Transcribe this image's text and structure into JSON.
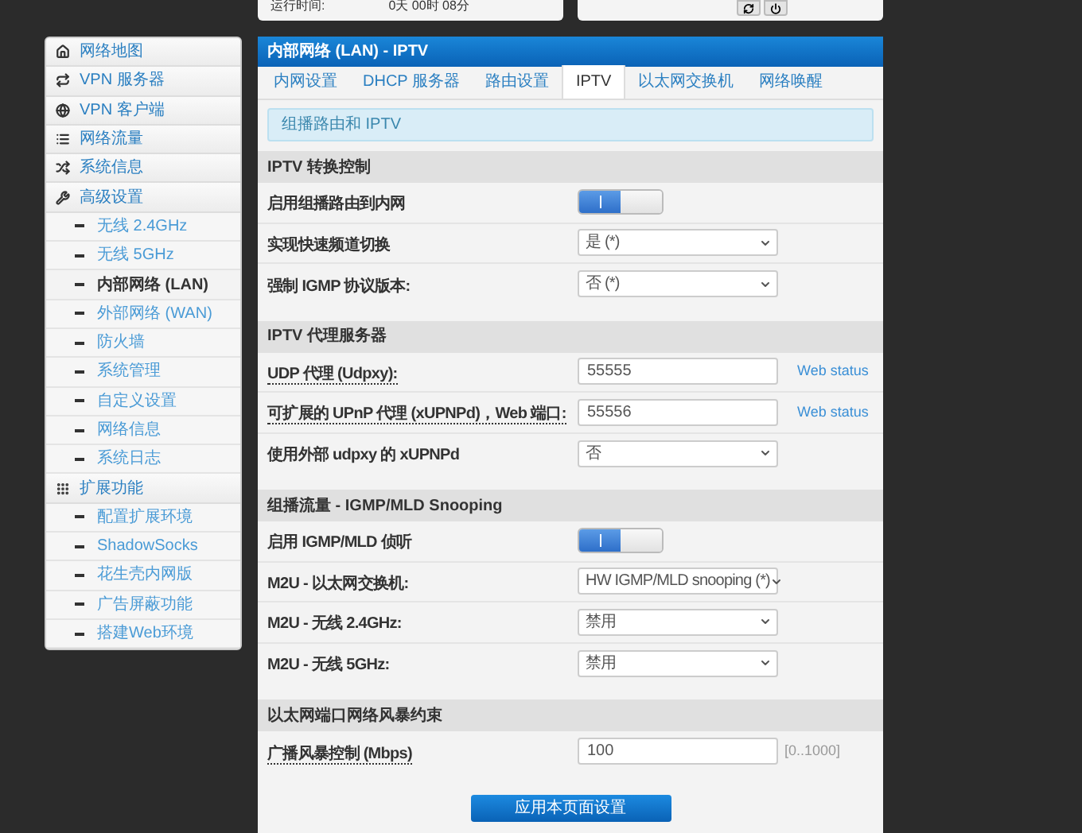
{
  "status_card": {
    "label": "运行时间:",
    "value": "0天 00时 08分"
  },
  "sidebar": {
    "items": [
      {
        "label": "网络地图",
        "selected": false
      },
      {
        "label": "VPN 服务器",
        "selected": false
      },
      {
        "label": "VPN 客户端",
        "selected": false
      },
      {
        "label": "网络流量",
        "selected": false
      },
      {
        "label": "系统信息",
        "selected": false
      },
      {
        "label": "高级设置",
        "selected": false,
        "children": [
          {
            "label": "无线 2.4GHz",
            "selected": false
          },
          {
            "label": "无线 5GHz",
            "selected": false
          },
          {
            "label": "内部网络 (LAN)",
            "selected": true
          },
          {
            "label": "外部网络 (WAN)",
            "selected": false
          },
          {
            "label": "防火墙",
            "selected": false
          },
          {
            "label": "系统管理",
            "selected": false
          },
          {
            "label": "自定义设置",
            "selected": false
          },
          {
            "label": "网络信息",
            "selected": false
          },
          {
            "label": "系统日志",
            "selected": false
          }
        ]
      },
      {
        "label": "扩展功能",
        "selected": false,
        "children": [
          {
            "label": "配置扩展环境",
            "selected": false
          },
          {
            "label": "ShadowSocks",
            "selected": false
          },
          {
            "label": "花生壳内网版",
            "selected": false
          },
          {
            "label": "广告屏蔽功能",
            "selected": false
          },
          {
            "label": "搭建Web环境",
            "selected": false
          }
        ]
      }
    ]
  },
  "panel": {
    "title": "内部网络 (LAN) - IPTV",
    "tabs": [
      {
        "label": "内网设置",
        "selected": false
      },
      {
        "label": "DHCP 服务器",
        "selected": false
      },
      {
        "label": "路由设置",
        "selected": false
      },
      {
        "label": "IPTV",
        "selected": true
      },
      {
        "label": "以太网交换机",
        "selected": false
      },
      {
        "label": "网络唤醒",
        "selected": false
      }
    ],
    "info": "组播路由和 IPTV",
    "sections": [
      {
        "title": "IPTV 转换控制",
        "rows": [
          {
            "kind": "toggle",
            "label": "启用组播路由到内网",
            "underlined": false,
            "on": true
          },
          {
            "kind": "select",
            "label": "实现快速频道切换",
            "underlined": false,
            "value": "是 (*)"
          },
          {
            "kind": "select",
            "label": "强制 IGMP 协议版本:",
            "underlined": false,
            "value": "否 (*)"
          }
        ]
      },
      {
        "title": "IPTV 代理服务器",
        "rows": [
          {
            "kind": "input",
            "label": "UDP 代理 (Udpxy):",
            "underlined": true,
            "value": "55555",
            "link": "Web status"
          },
          {
            "kind": "input",
            "label": "可扩展的 UPnP 代理 (xUPNPd)，Web 端口:",
            "underlined": true,
            "value": "55556",
            "link": "Web status"
          },
          {
            "kind": "select",
            "label": "使用外部 udpxy 的 xUPNPd",
            "underlined": false,
            "value": "否"
          }
        ]
      },
      {
        "title": "组播流量 - IGMP/MLD Snooping",
        "rows": [
          {
            "kind": "toggle",
            "label": "启用 IGMP/MLD 侦听",
            "underlined": false,
            "on": true
          },
          {
            "kind": "select",
            "label": "M2U - 以太网交换机:",
            "underlined": false,
            "value": "HW IGMP/MLD snooping (*)"
          },
          {
            "kind": "select",
            "label": "M2U - 无线 2.4GHz:",
            "underlined": false,
            "value": "禁用"
          },
          {
            "kind": "select",
            "label": "M2U - 无线 5GHz:",
            "underlined": false,
            "value": "禁用"
          }
        ]
      },
      {
        "title": "以太网端口网络风暴约束",
        "rows": [
          {
            "kind": "input",
            "label": "广播风暴控制 (Mbps)",
            "underlined": true,
            "value": "100",
            "hint": "[0..1000]"
          }
        ]
      }
    ],
    "apply_button": "应用本页面设置"
  }
}
